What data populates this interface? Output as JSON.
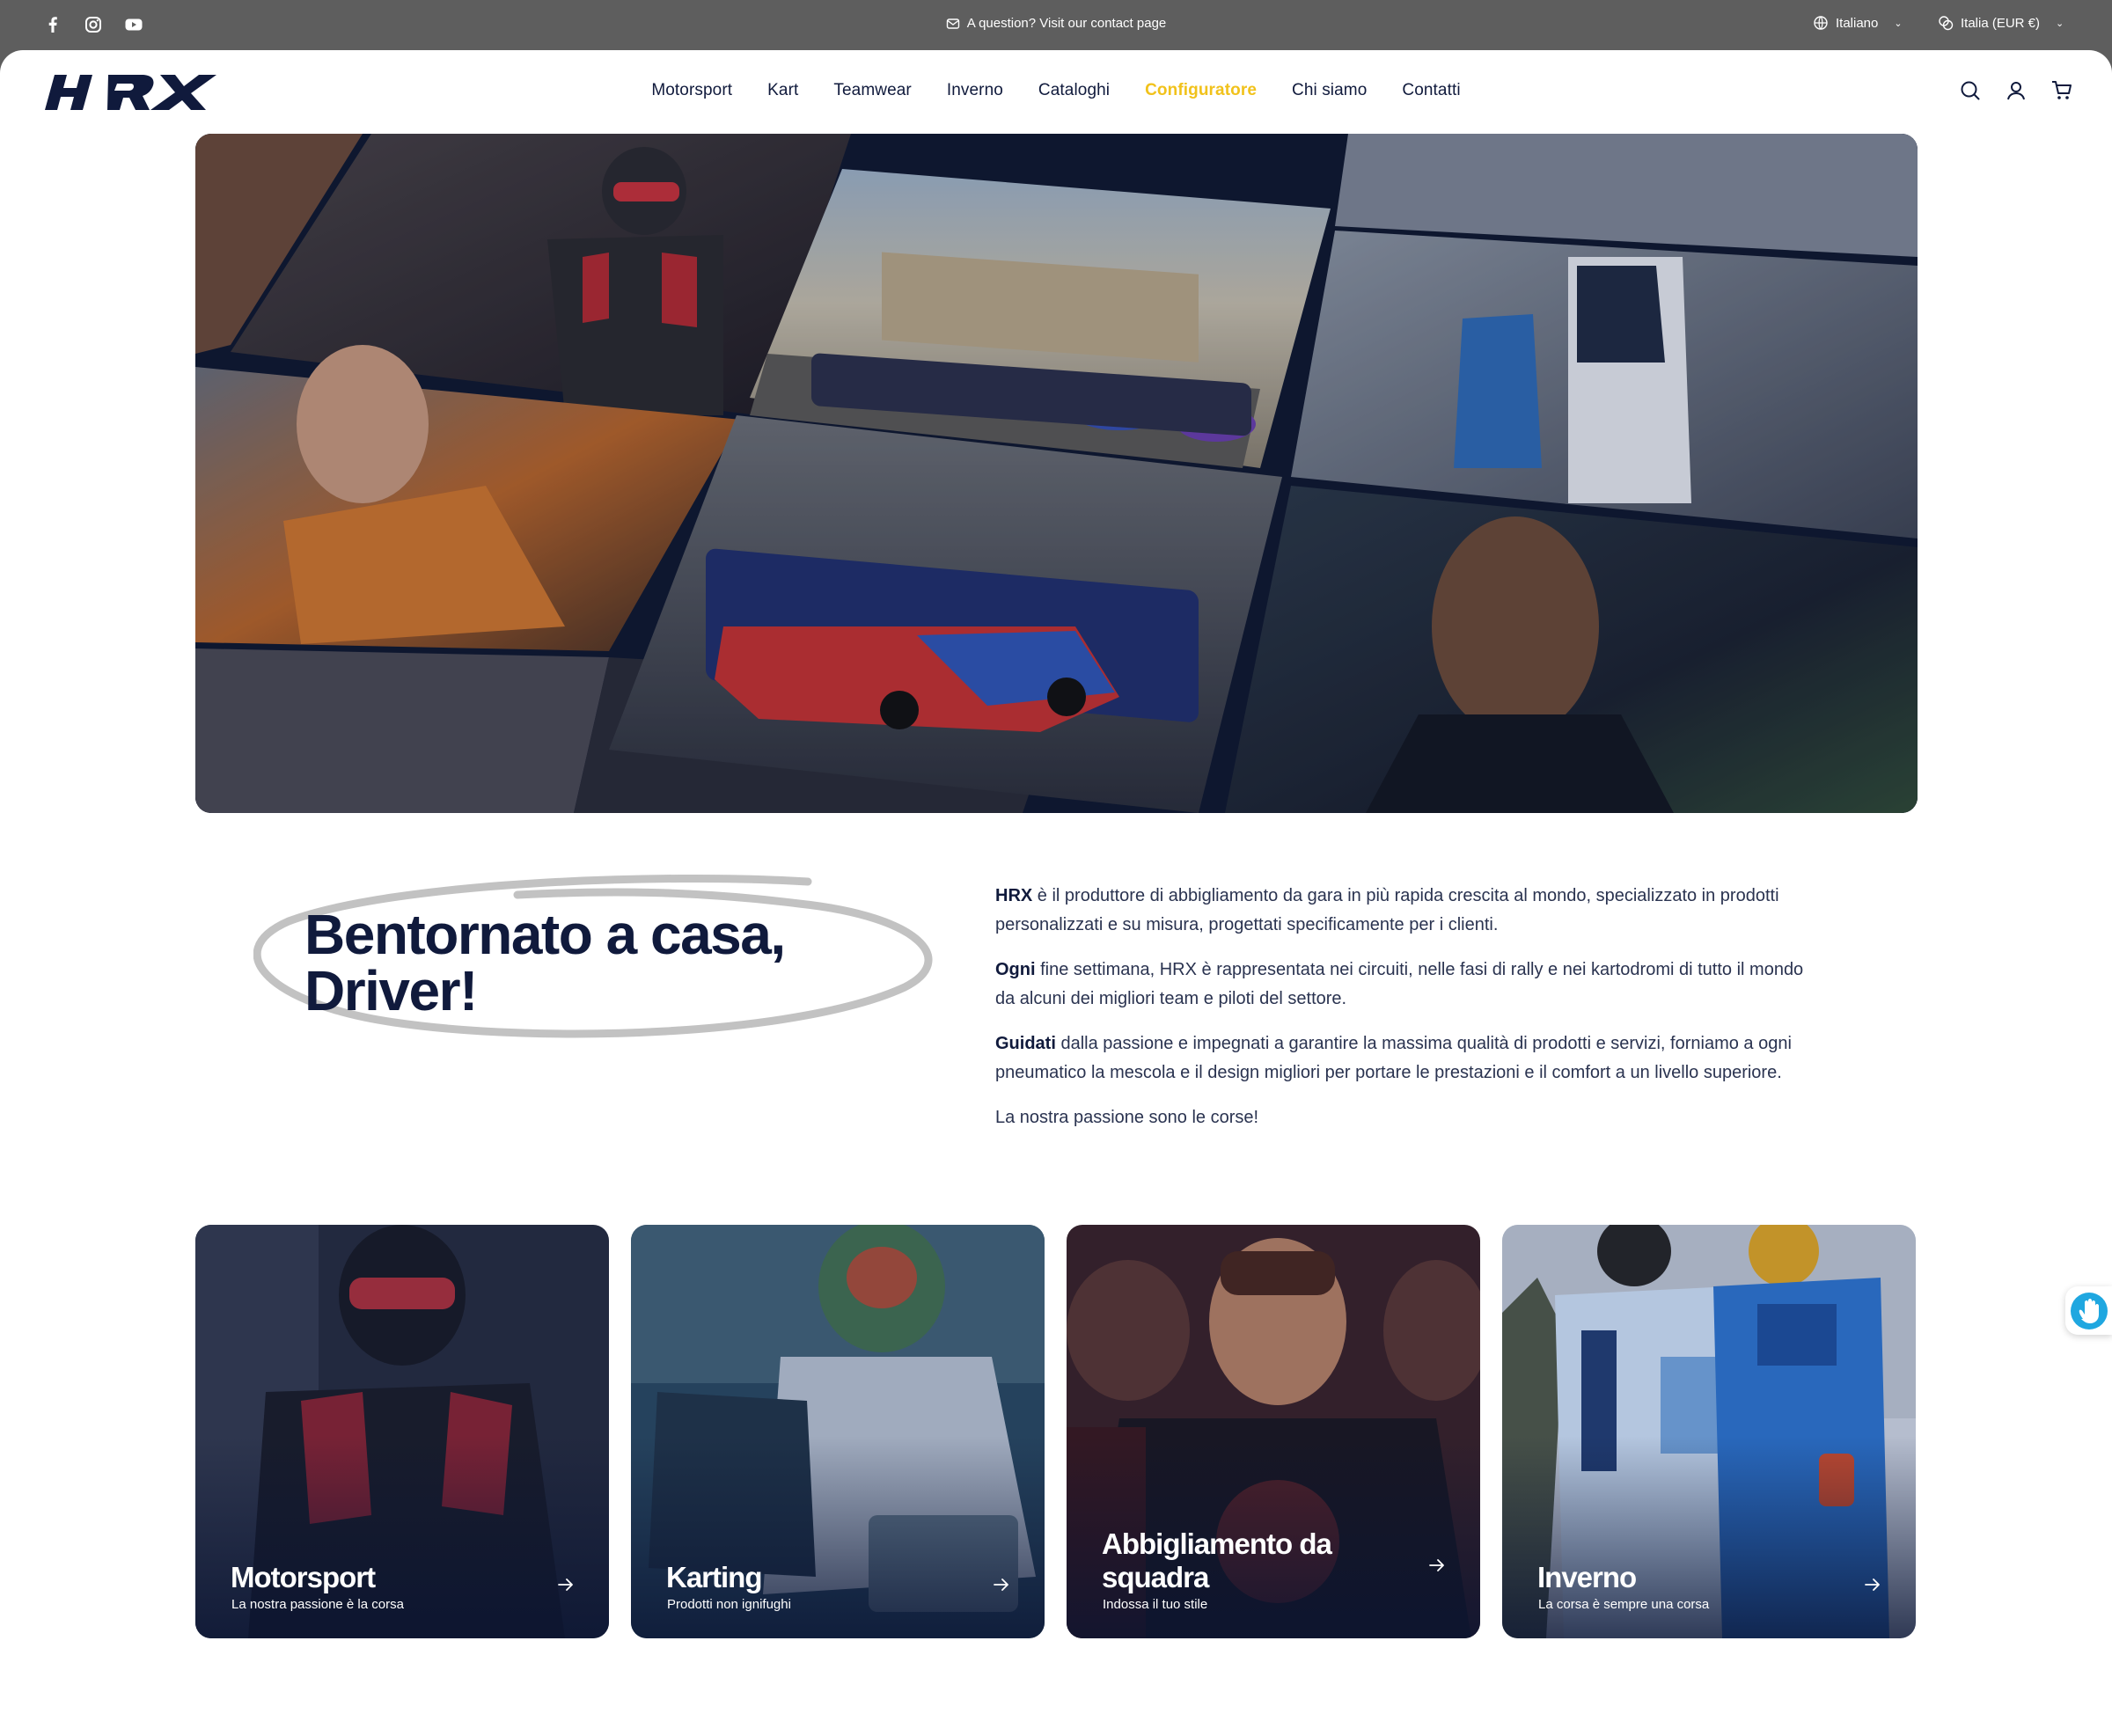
{
  "topbar": {
    "announcement": "A question? Visit our contact page",
    "language": "Italiano",
    "country_currency": "Italia (EUR €)",
    "social": [
      "facebook-icon",
      "instagram-icon",
      "youtube-icon"
    ]
  },
  "header": {
    "logo_text": "HRX",
    "nav": [
      {
        "label": "Motorsport"
      },
      {
        "label": "Kart"
      },
      {
        "label": "Teamwear"
      },
      {
        "label": "Inverno"
      },
      {
        "label": "Cataloghi"
      },
      {
        "label": "Configuratore"
      },
      {
        "label": "Chi siamo"
      },
      {
        "label": "Contatti"
      }
    ],
    "icons": [
      "search-icon",
      "account-icon",
      "cart-icon"
    ]
  },
  "intro": {
    "title_line1": "Bentornato a casa,",
    "title_line2": "Driver!",
    "paragraphs": [
      {
        "lead": "HRX",
        "text": " è il produttore di abbigliamento da gara in più rapida crescita al mondo, specializzato in prodotti personalizzati e su misura, progettati specificamente per i clienti."
      },
      {
        "lead": "Ogni",
        "text": " fine settimana, HRX è rappresentata nei circuiti, nelle fasi di rally e nei kartodromi di tutto il mondo da alcuni dei migliori team e piloti del settore."
      },
      {
        "lead": "Guidati",
        "text": " dalla passione e impegnati a garantire la massima qualità di prodotti e servizi, forniamo a ogni pneumatico la mescola e il design migliori per portare le prestazioni e il comfort a un livello superiore."
      },
      {
        "lead": "",
        "text": "La nostra passione sono le corse!"
      }
    ]
  },
  "cards": [
    {
      "title": "Motorsport",
      "subtitle": "La nostra passione è la corsa"
    },
    {
      "title": "Karting",
      "subtitle": "Prodotti non ignifughi"
    },
    {
      "title": "Abbigliamento da squadra",
      "subtitle": "Indossa il tuo stile"
    },
    {
      "title": "Inverno",
      "subtitle": "La corsa è sempre una corsa"
    }
  ],
  "colors": {
    "accent": "#f1c21b",
    "brand_navy": "#101a3c",
    "topbar": "#5e5e5e"
  }
}
